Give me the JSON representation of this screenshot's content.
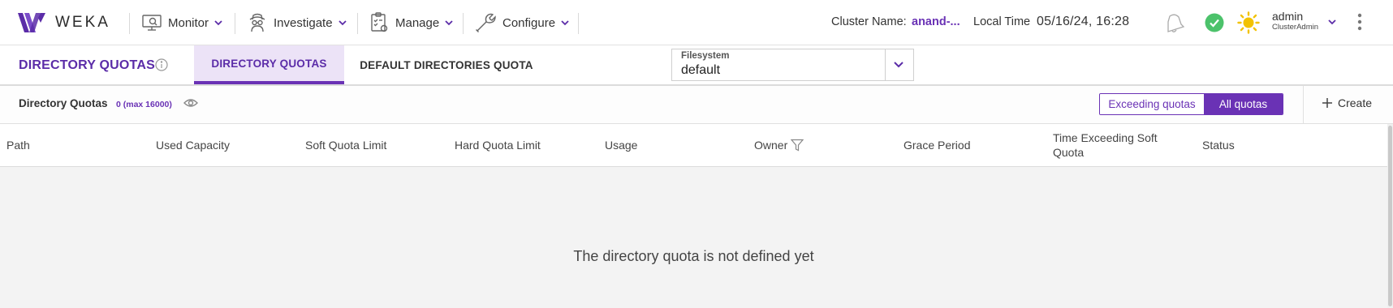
{
  "brand": {
    "name": "WEKA",
    "logo_icon": "weka-logo-icon"
  },
  "nav": {
    "menus": [
      {
        "label": "Monitor",
        "icon": "monitor-icon"
      },
      {
        "label": "Investigate",
        "icon": "investigate-icon"
      },
      {
        "label": "Manage",
        "icon": "manage-icon"
      },
      {
        "label": "Configure",
        "icon": "wrench-icon"
      }
    ],
    "cluster_label": "Cluster Name:",
    "cluster_value": "anand-...",
    "local_time_label": "Local Time",
    "local_time_value": "05/16/24, 16:28",
    "user": {
      "name": "admin",
      "role": "ClusterAdmin"
    },
    "colors": {
      "accent": "#6a32b5",
      "status_ok": "#4cc26b",
      "theme_sun": "#f2c200"
    }
  },
  "tabbar": {
    "page_title": "DIRECTORY QUOTAS",
    "tabs": [
      {
        "label": "DIRECTORY QUOTAS",
        "active": true
      },
      {
        "label": "DEFAULT DIRECTORIES QUOTA",
        "active": false
      }
    ],
    "filesystem": {
      "label": "Filesystem",
      "value": "default"
    }
  },
  "toolbar": {
    "title": "Directory Quotas",
    "count": "0 (max 16000)",
    "filters": [
      {
        "label": "Exceeding quotas",
        "selected": false
      },
      {
        "label": "All quotas",
        "selected": true
      }
    ],
    "create_label": "Create"
  },
  "table": {
    "columns": [
      "Path",
      "Used Capacity",
      "Soft Quota Limit",
      "Hard Quota Limit",
      "Usage",
      "Owner",
      "Grace Period",
      "Time Exceeding Soft Quota",
      "Status"
    ],
    "column_time_line1": "Time Exceeding Soft",
    "column_time_line2": "Quota",
    "empty_message": "The directory quota is not defined yet"
  }
}
